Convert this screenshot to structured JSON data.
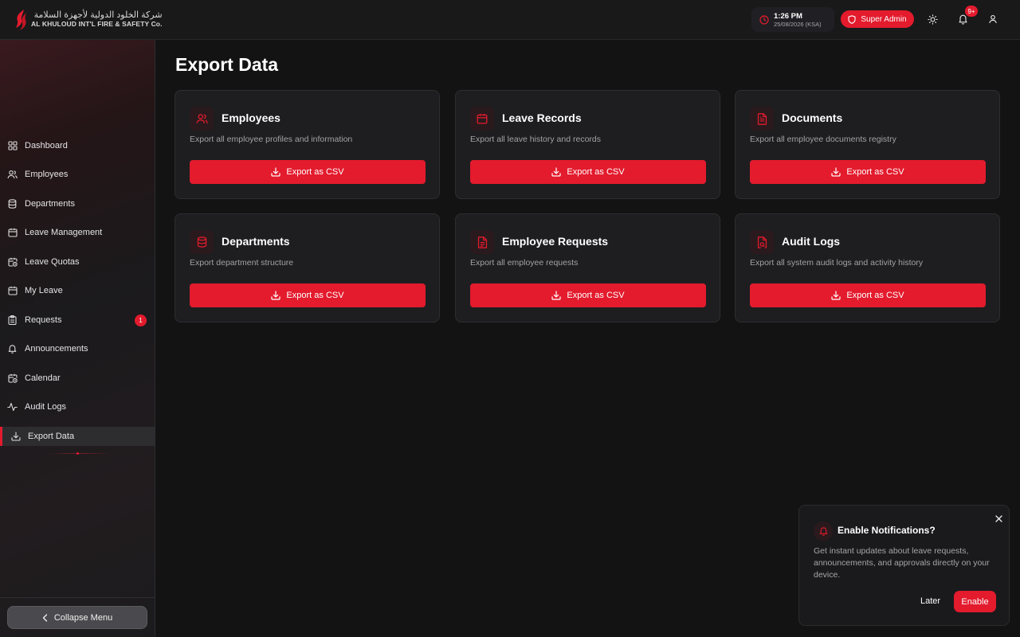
{
  "header": {
    "logo_arabic": "شركة الخلود الدولية لأجهزة السلامة",
    "logo_english": "AL KHULOUD INT'L FIRE & SAFETY Co.",
    "time": "1:26 PM",
    "date": "25/08/2026 (KSA)",
    "role": "Super Admin",
    "notification_count": "9+"
  },
  "sidebar": {
    "items": [
      {
        "label": "Dashboard",
        "icon": "dashboard-icon"
      },
      {
        "label": "Employees",
        "icon": "users-icon"
      },
      {
        "label": "Departments",
        "icon": "database-icon"
      },
      {
        "label": "Leave Management",
        "icon": "calendar-icon"
      },
      {
        "label": "Leave Quotas",
        "icon": "calendar-clock-icon"
      },
      {
        "label": "My Leave",
        "icon": "calendar-icon"
      },
      {
        "label": "Requests",
        "icon": "clipboard-icon",
        "badge": "1"
      },
      {
        "label": "Announcements",
        "icon": "bell-icon"
      },
      {
        "label": "Calendar",
        "icon": "calendar-clock-icon"
      },
      {
        "label": "Audit Logs",
        "icon": "activity-icon"
      },
      {
        "label": "Export Data",
        "icon": "download-icon",
        "active": true
      }
    ],
    "collapse_label": "Collapse Menu"
  },
  "main": {
    "title": "Export Data",
    "cards": [
      {
        "title": "Employees",
        "desc": "Export all employee profiles and information",
        "button": "Export as CSV",
        "icon": "users-icon"
      },
      {
        "title": "Leave Records",
        "desc": "Export all leave history and records",
        "button": "Export as CSV",
        "icon": "calendar-icon"
      },
      {
        "title": "Documents",
        "desc": "Export all employee documents registry",
        "button": "Export as CSV",
        "icon": "document-icon"
      },
      {
        "title": "Departments",
        "desc": "Export department structure",
        "button": "Export as CSV",
        "icon": "database-icon"
      },
      {
        "title": "Employee Requests",
        "desc": "Export all employee requests",
        "button": "Export as CSV",
        "icon": "file-text-icon"
      },
      {
        "title": "Audit Logs",
        "desc": "Export all system audit logs and activity history",
        "button": "Export as CSV",
        "icon": "file-audit-icon"
      }
    ]
  },
  "popup": {
    "title": "Enable Notifications?",
    "text": "Get instant updates about leave requests, announcements, and approvals directly on your device.",
    "later": "Later",
    "enable": "Enable"
  },
  "colors": {
    "accent": "#e31b2d",
    "background": "#131314",
    "card": "#1e1e20"
  }
}
